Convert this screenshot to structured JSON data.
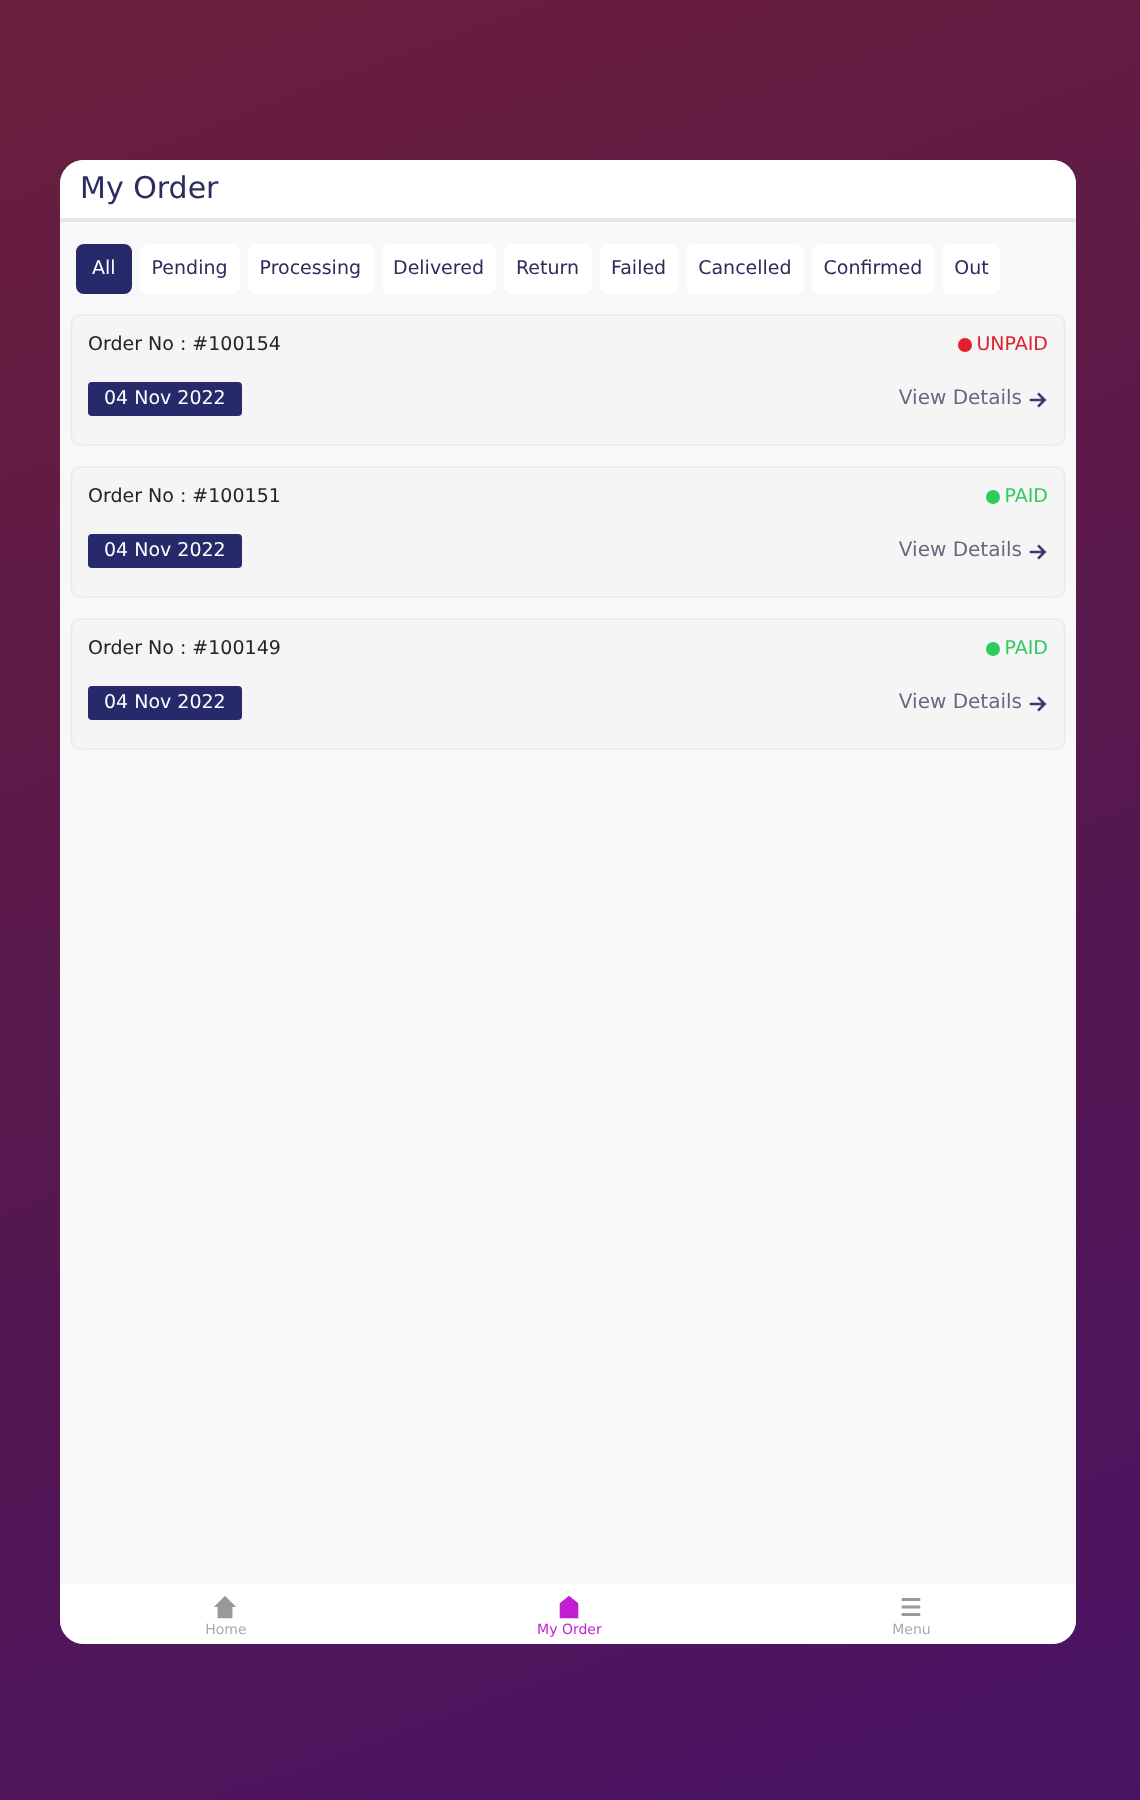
{
  "header": {
    "title": "My Order"
  },
  "tabs": [
    {
      "label": "All",
      "selected": true
    },
    {
      "label": "Pending",
      "selected": false
    },
    {
      "label": "Processing",
      "selected": false
    },
    {
      "label": "Delivered",
      "selected": false
    },
    {
      "label": "Return",
      "selected": false
    },
    {
      "label": "Failed",
      "selected": false
    },
    {
      "label": "Cancelled",
      "selected": false
    },
    {
      "label": "Confirmed",
      "selected": false
    },
    {
      "label": "Out",
      "selected": false
    }
  ],
  "orders": [
    {
      "number": "Order No : #100154",
      "status": "UNPAID",
      "paid": false,
      "date": "04 Nov 2022",
      "link": "View Details"
    },
    {
      "number": "Order No : #100151",
      "status": "PAID",
      "paid": true,
      "date": "04 Nov 2022",
      "link": "View Details"
    },
    {
      "number": "Order No : #100149",
      "status": "PAID",
      "paid": true,
      "date": "04 Nov 2022",
      "link": "View Details"
    }
  ],
  "nav": [
    {
      "label": "Home",
      "kind": "home",
      "selected": false
    },
    {
      "label": "My Order",
      "kind": "order",
      "selected": true
    },
    {
      "label": "Menu",
      "kind": "menu",
      "selected": false
    }
  ]
}
